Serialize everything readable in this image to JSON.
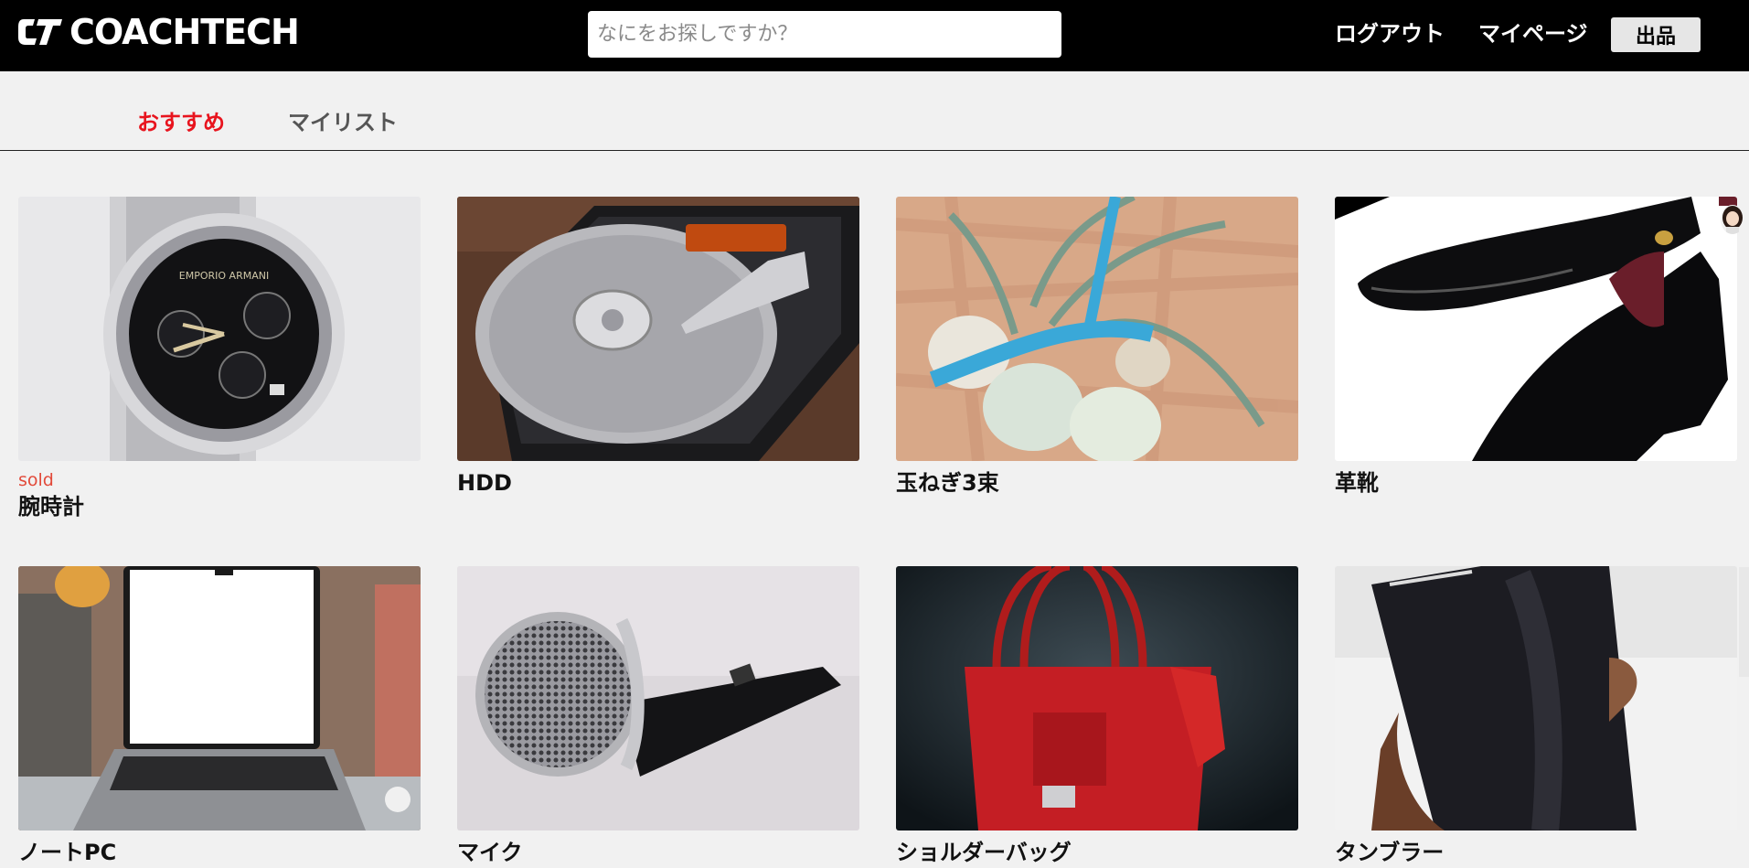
{
  "header": {
    "logo_text": "COACHTECH",
    "search_placeholder": "なにをお探しですか？",
    "logout_label": "ログアウト",
    "mypage_label": "マイページ",
    "sell_label": "出品"
  },
  "tabs": {
    "recommended": "おすすめ",
    "mylist": "マイリスト",
    "active_color": "#e8141e",
    "inactive_color": "#555555"
  },
  "items": [
    {
      "name": "腕時計",
      "sold_label": "sold",
      "image": "wristwatch-photo"
    },
    {
      "name": "HDD",
      "image": "hard-drive-photo"
    },
    {
      "name": "玉ねぎ3束",
      "image": "onion-bundle-photo"
    },
    {
      "name": "革靴",
      "image": "leather-shoes-photo"
    },
    {
      "name": "ノートPC",
      "image": "laptop-photo"
    },
    {
      "name": "マイク",
      "image": "microphone-photo"
    },
    {
      "name": "ショルダーバッグ",
      "image": "shoulder-bag-photo"
    },
    {
      "name": "タンブラー",
      "image": "tumbler-photo"
    }
  ]
}
